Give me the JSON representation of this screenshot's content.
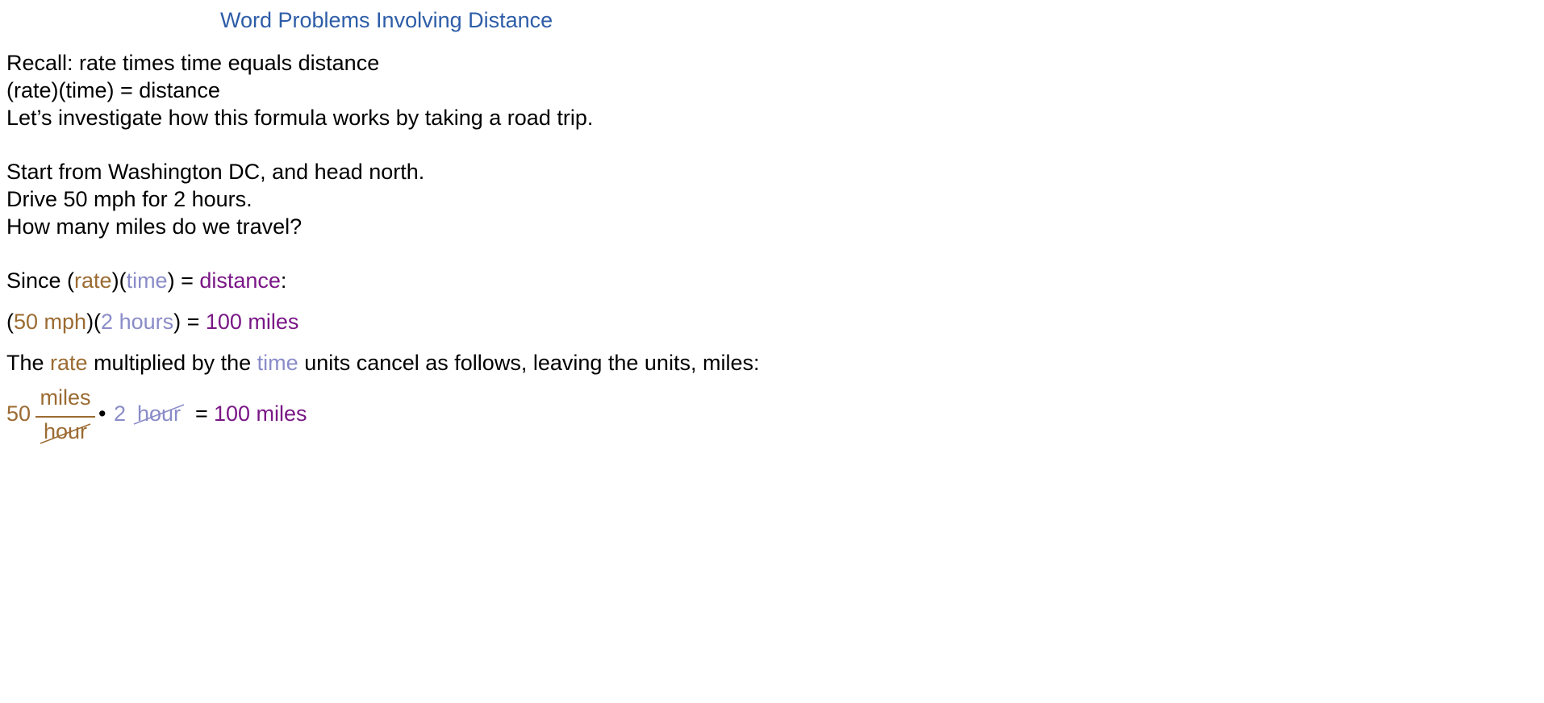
{
  "title": "Word Problems Involving Distance",
  "intro": {
    "line1": "Recall:  rate times time equals distance",
    "line2": "(rate)(time) = distance",
    "line3": "Let’s investigate how this formula works by taking a road trip."
  },
  "problem": {
    "line1": "Start from Washington DC, and head north.",
    "line2": "Drive 50 mph for 2 hours.",
    "line3": "How many miles do we travel?"
  },
  "since_line": {
    "prefix": "Since (",
    "rate": "rate",
    "mid1": ")(",
    "time": "time",
    "mid2": ") = ",
    "distance": "distance",
    "suffix": ":"
  },
  "computation_line": {
    "open": "(",
    "rate": "50 mph",
    "mid": ")(",
    "time": "2 hours",
    "close": ") = ",
    "result": "100 miles"
  },
  "explain_line": {
    "part1": "The ",
    "rate": "rate",
    "part2": " multiplied by the ",
    "time": "time",
    "part3": " units cancel as follows, leaving the units, miles:"
  },
  "fraction_line": {
    "rate_value": "50",
    "numerator": "miles",
    "denominator": "hour",
    "dot": "•",
    "time_value": "2",
    "time_unit": "hour",
    "equals": "=",
    "result": "100 miles"
  },
  "colors": {
    "title": "#2e5da8",
    "rate": "#9b6b32",
    "time": "#8a8cc8",
    "distance": "#7a1786"
  }
}
